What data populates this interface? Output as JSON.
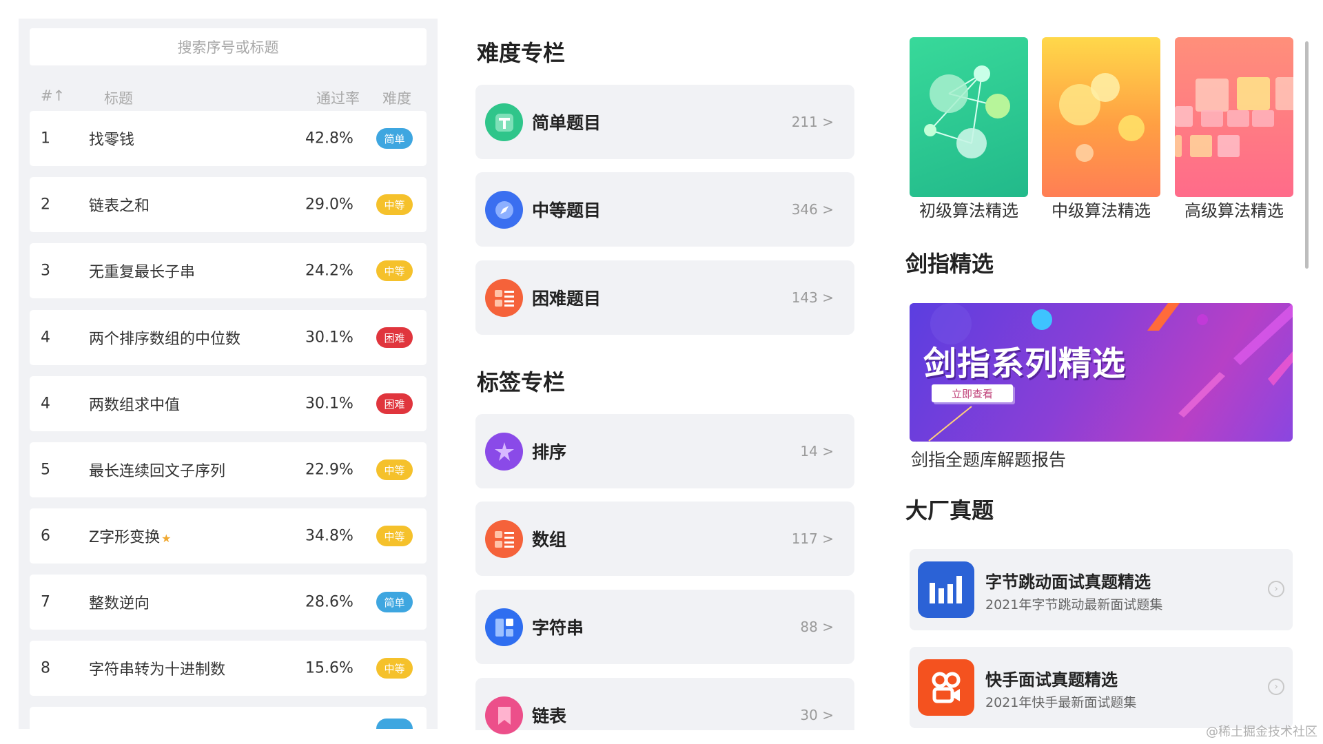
{
  "search": {
    "placeholder": "搜索序号或标题"
  },
  "list_header": {
    "index": "#↑",
    "title": "标题",
    "rate": "通过率",
    "difficulty": "难度"
  },
  "problems": [
    {
      "index": "1",
      "title": "找零钱",
      "rate": "42.8%",
      "badge": "简单",
      "level": "easy"
    },
    {
      "index": "2",
      "title": "链表之和",
      "rate": "29.0%",
      "badge": "中等",
      "level": "medium"
    },
    {
      "index": "3",
      "title": "无重复最长子串",
      "rate": "24.2%",
      "badge": "中等",
      "level": "medium"
    },
    {
      "index": "4",
      "title": "两个排序数组的中位数",
      "rate": "30.1%",
      "badge": "困难",
      "level": "hard"
    },
    {
      "index": "4",
      "title": "两数组求中值",
      "rate": "30.1%",
      "badge": "困难",
      "level": "hard"
    },
    {
      "index": "5",
      "title": "最长连续回文子序列",
      "rate": "22.9%",
      "badge": "中等",
      "level": "medium"
    },
    {
      "index": "6",
      "title": "Z字形变换",
      "rate": "34.8%",
      "badge": "中等",
      "level": "medium",
      "starred": true
    },
    {
      "index": "7",
      "title": "整数逆向",
      "rate": "28.6%",
      "badge": "简单",
      "level": "easy"
    },
    {
      "index": "8",
      "title": "字符串转为十进制数",
      "rate": "15.6%",
      "badge": "中等",
      "level": "medium"
    }
  ],
  "difficulty_section": {
    "title": "难度专栏",
    "items": [
      {
        "label": "简单题目",
        "count": "211 >",
        "icon": "easy-icon",
        "color": "#2fc58a"
      },
      {
        "label": "中等题目",
        "count": "346 >",
        "icon": "compass-icon",
        "color": "#3a6ff0"
      },
      {
        "label": "困难题目",
        "count": "143 >",
        "icon": "list-icon",
        "color": "#f5623a"
      }
    ]
  },
  "tag_section": {
    "title": "标签专栏",
    "items": [
      {
        "label": "排序",
        "count": "14 >",
        "icon": "star-burst-icon",
        "color": "#8a4ae8"
      },
      {
        "label": "数组",
        "count": "117 >",
        "icon": "list-icon",
        "color": "#f5623a"
      },
      {
        "label": "字符串",
        "count": "88 >",
        "icon": "layout-icon",
        "color": "#2f6ef0"
      },
      {
        "label": "链表",
        "count": "30 >",
        "icon": "bookmark-icon",
        "color": "#ec4f8a"
      }
    ]
  },
  "courses": [
    {
      "label": "初级算法精选",
      "icon": "molecule-icon"
    },
    {
      "label": "中级算法精选",
      "icon": "bubbles-icon"
    },
    {
      "label": "高级算法精选",
      "icon": "blocks-icon"
    }
  ],
  "jianzhi": {
    "title": "剑指精选",
    "banner_heading": "剑指系列精选",
    "banner_button": "立即查看",
    "caption": "剑指全题库解题报告"
  },
  "companies": {
    "title": "大厂真题",
    "items": [
      {
        "name": "字节跳动面试真题精选",
        "sub": "2021年字节跳动最新面试题集",
        "icon": "bytedance-icon",
        "color": "#2b62d6"
      },
      {
        "name": "快手面试真题精选",
        "sub": "2021年快手最新面试题集",
        "icon": "kuaishou-icon",
        "color": "#f4521f"
      }
    ]
  },
  "watermark": "@稀土掘金技术社区"
}
